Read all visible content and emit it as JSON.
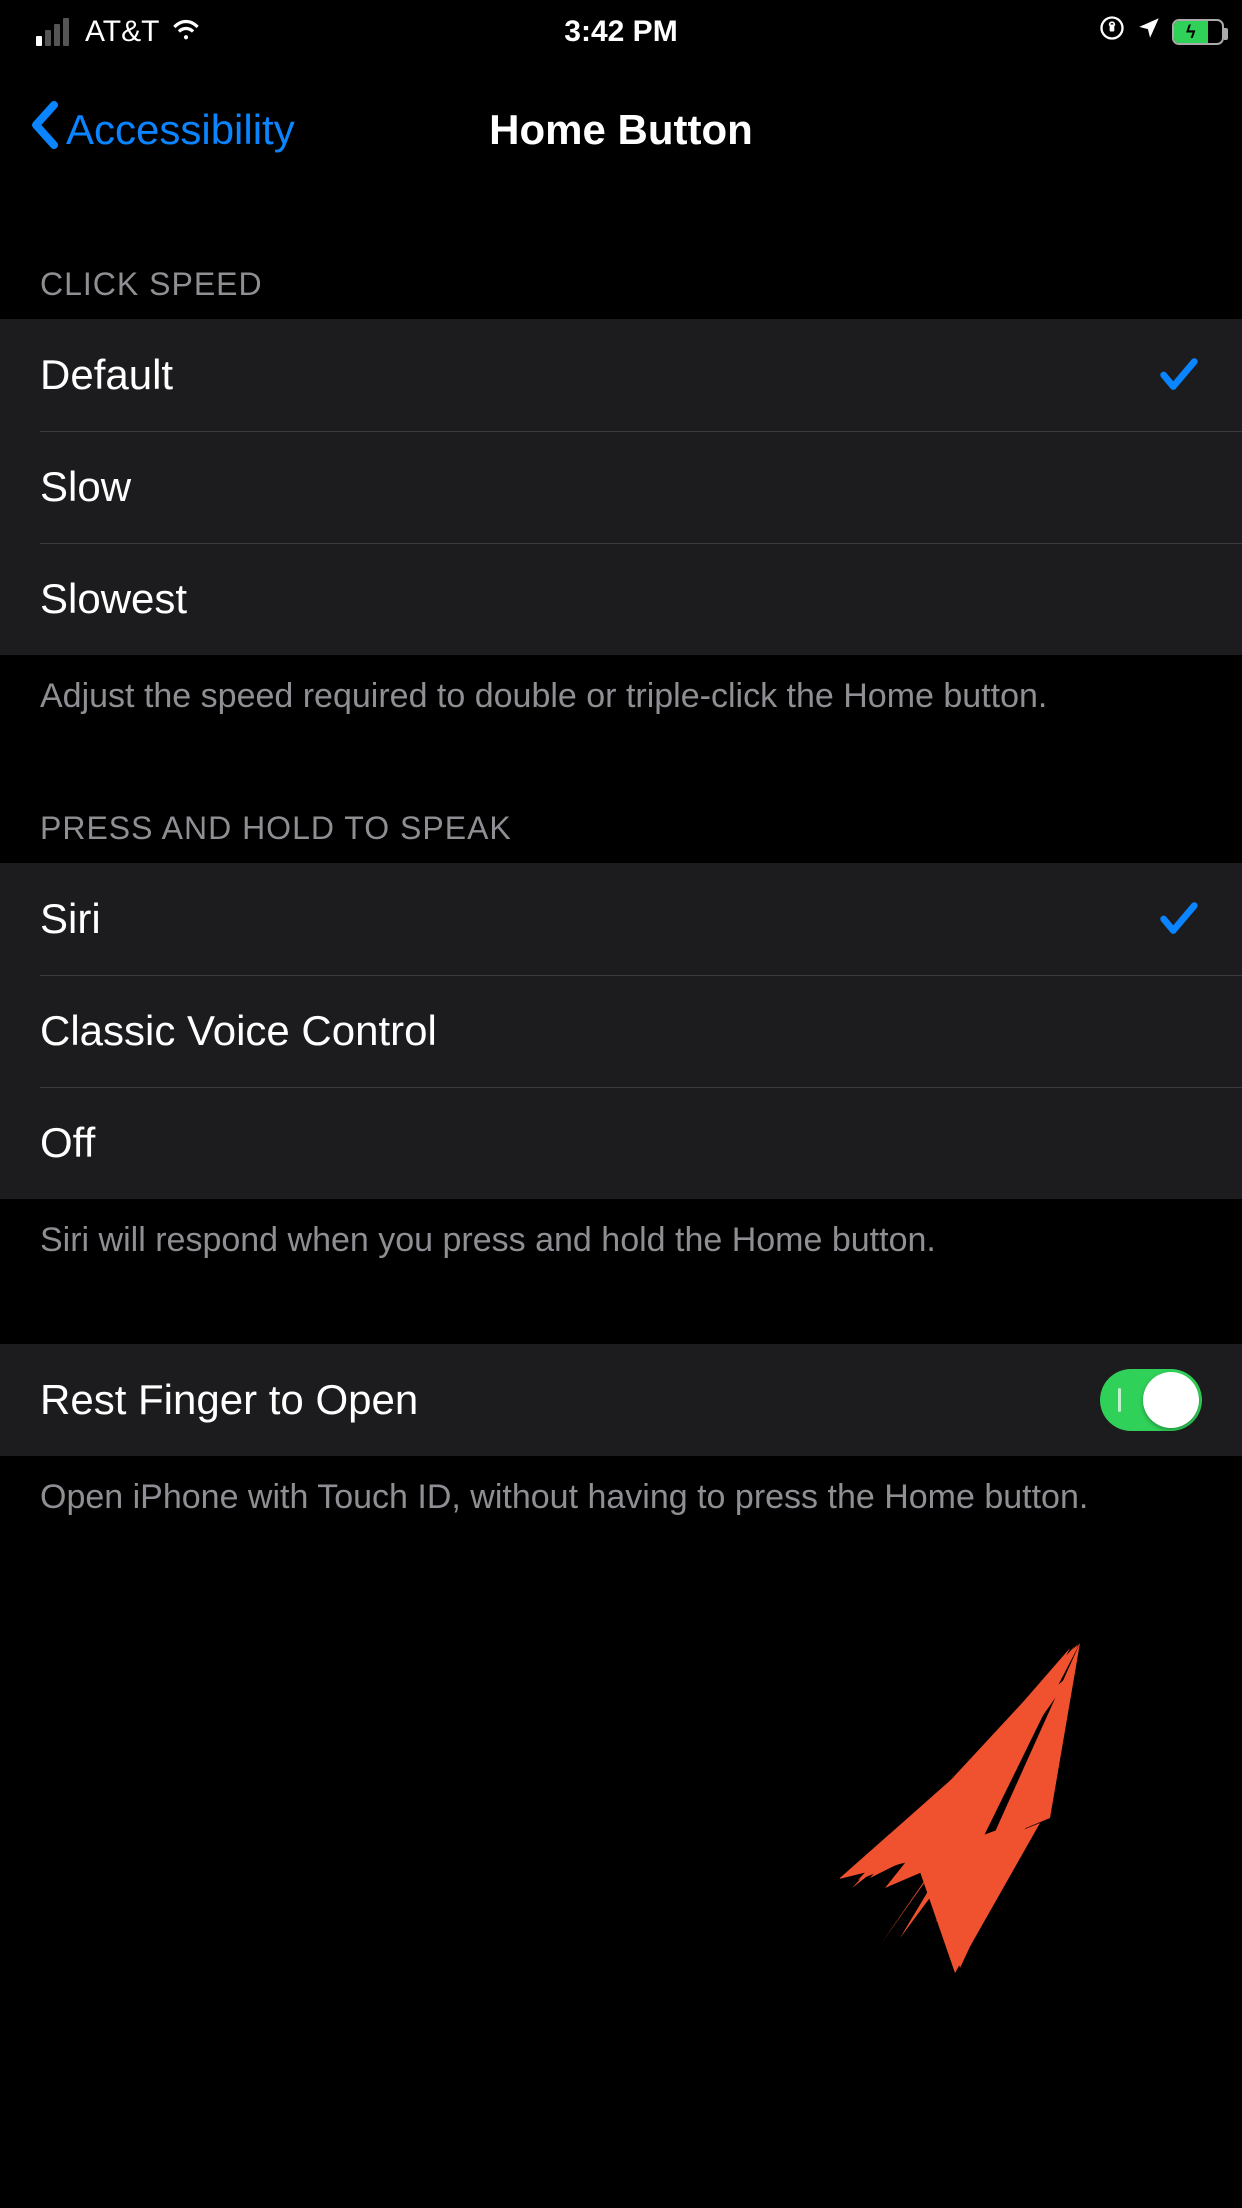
{
  "status_bar": {
    "carrier": "AT&T",
    "time": "3:42 PM"
  },
  "nav": {
    "back_label": "Accessibility",
    "title": "Home Button"
  },
  "sections": {
    "click_speed": {
      "header": "CLICK SPEED",
      "options": [
        {
          "label": "Default",
          "selected": true
        },
        {
          "label": "Slow",
          "selected": false
        },
        {
          "label": "Slowest",
          "selected": false
        }
      ],
      "footer": "Adjust the speed required to double or triple-click the Home button."
    },
    "press_hold": {
      "header": "PRESS AND HOLD TO SPEAK",
      "options": [
        {
          "label": "Siri",
          "selected": true
        },
        {
          "label": "Classic Voice Control",
          "selected": false
        },
        {
          "label": "Off",
          "selected": false
        }
      ],
      "footer": "Siri will respond when you press and hold the Home button."
    },
    "rest_finger": {
      "label": "Rest Finger to Open",
      "value": true,
      "footer": "Open iPhone with Touch ID, without having to press the Home button."
    }
  },
  "colors": {
    "accent": "#0a84ff",
    "toggle_on": "#30d158",
    "annotation": "#f0512f"
  }
}
